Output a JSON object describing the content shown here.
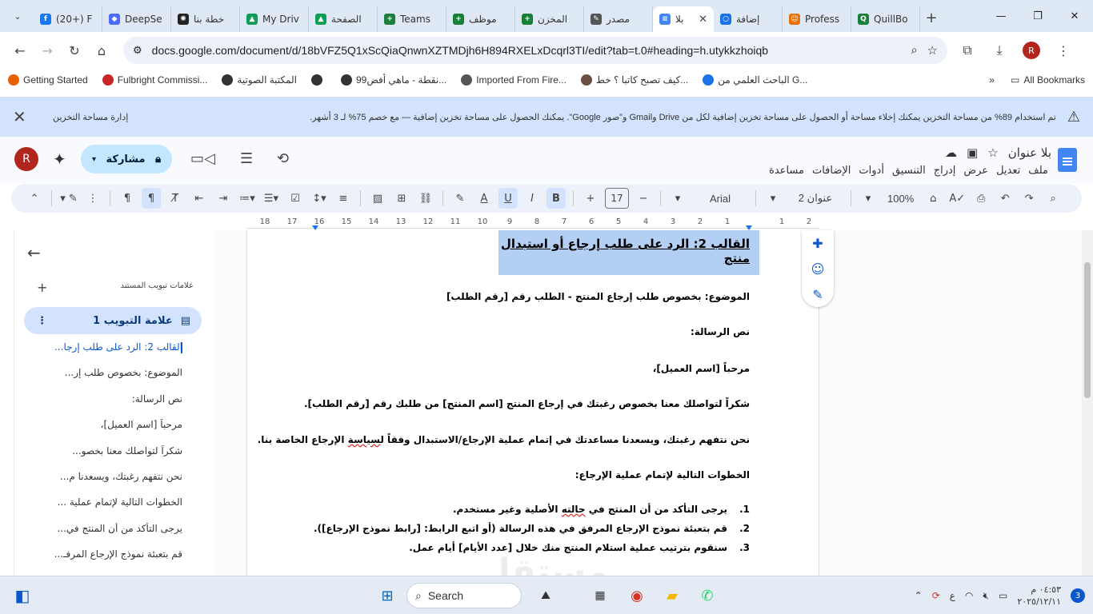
{
  "browser": {
    "tabs": [
      {
        "label": "(20+) F",
        "color": "#1877f2",
        "glyph": "f"
      },
      {
        "label": "DeepSe",
        "color": "#4d6bfe",
        "glyph": "◆"
      },
      {
        "label": "خطة بنا",
        "color": "#222222",
        "glyph": "✺"
      },
      {
        "label": "My Driv",
        "color": "#0f9d58",
        "glyph": "▲"
      },
      {
        "label": "الصفحة",
        "color": "#0f9d58",
        "glyph": "▲"
      },
      {
        "label": "Teams",
        "color": "#188038",
        "glyph": "+"
      },
      {
        "label": "موظف",
        "color": "#188038",
        "glyph": "+"
      },
      {
        "label": "المخزن",
        "color": "#188038",
        "glyph": "+"
      },
      {
        "label": "مصدر",
        "color": "#555555",
        "glyph": "✎"
      },
      {
        "label": "بلا",
        "color": "#4285f4",
        "glyph": "≡",
        "active": true
      },
      {
        "label": "إضافة",
        "color": "#1a73e8",
        "glyph": "○"
      },
      {
        "label": "Profess",
        "color": "#e8710a",
        "glyph": "☺"
      },
      {
        "label": "QuillBo",
        "color": "#188038",
        "glyph": "Q"
      }
    ],
    "url": "docs.google.com/document/d/18bVFZ5Q1xScQiaQnwnXZTMDjh6H894RXELxDcqrl3TI/edit?tab=t.0#heading=h.utykkzhoiqb",
    "profile_initial": "R"
  },
  "bookmarks": {
    "items": [
      {
        "label": "Getting Started",
        "color": "#e66000"
      },
      {
        "label": "Fulbright Commissi...",
        "color": "#c62828"
      },
      {
        "label": "المكتبة الصوتية",
        "color": "#333333"
      },
      {
        "label": "",
        "color": "#333333"
      },
      {
        "label": "99نقطة - ماهي أفض...",
        "color": "#333333"
      },
      {
        "label": "Imported From Fire...",
        "color": "#555555"
      },
      {
        "label": "كيف تصبح كاتبا ؟ خط...",
        "color": "#6d4c41"
      },
      {
        "label": "الباحث العلمي من G...",
        "color": "#1a73e8"
      }
    ],
    "more": "»",
    "all": "All Bookmarks"
  },
  "banner": {
    "manage": "إدارة مساحة التخزين",
    "message": "تم استخدام 89% من مساحة التخزين   يمكنك إخلاء مساحة أو الحصول على مساحة تخزين إضافية لكل من Drive وGmail و\"صور Google\". يمكنك الحصول على مساحة تخزين إضافية — مع خصم 75% لـ 3 أشهر."
  },
  "docs": {
    "user_initial": "R",
    "share_label": "مشاركة",
    "title": "بلا عنوان",
    "menus": [
      "ملف",
      "تعديل",
      "عرض",
      "إدراج",
      "التنسيق",
      "أدوات",
      "الإضافات",
      "مساعدة"
    ],
    "toolbar": {
      "zoom": "100%",
      "style": "عنوان 2",
      "font": "Arial",
      "size": "17"
    }
  },
  "ruler": {
    "numbers": [
      "2",
      "1",
      "",
      "1",
      "2",
      "3",
      "4",
      "5",
      "6",
      "7",
      "8",
      "9",
      "10",
      "11",
      "12",
      "13",
      "14",
      "15",
      "16",
      "17",
      "18"
    ]
  },
  "outline": {
    "tabs_title": "علامات تبويب المستند",
    "tab_label": "علامة التبويب 1",
    "items": [
      "القالب 2: الرد على طلب إرجا...",
      "الموضوع: بخصوص طلب إر...",
      "نص الرسالة:",
      "مرحباً [اسم العميل]،",
      "شكراً لتواصلك معنا بخصو...",
      "نحن نتفهم رغبتك، ويسعدنا م...",
      "الخطوات التالية لإتمام عملية ...",
      "يرجى التأكد من أن المنتج في...",
      "قم بتعبئة نموذج الإرجاع المرفـ..."
    ]
  },
  "document": {
    "heading": "القالب 2: الرد على طلب إرجاع أو استبدال منتج",
    "subject": "الموضوع: بخصوص طلب إرجاع المنتج - الطلب رقم [رقم الطلب]",
    "body_label": "نص الرسالة:",
    "greeting": "مرحباً [اسم العميل]،",
    "thanks": "شكراً لتواصلك معنا بخصوص رغبتك في إرجاع المنتج [اسم المنتج] من طلبك رقم [رقم الطلب].",
    "understand_pre": "نحن نتفهم رغبتك، ويسعدنا مساعدتك في إتمام عملية الإرجاع/الاستبدال وفقاً ل",
    "understand_squig": "سياسة",
    "understand_post": " الإرجاع الخاصة بنا.",
    "next_steps": "الخطوات التالية لإتمام عملية الإرجاع:",
    "steps": [
      {
        "n": "1.",
        "pre": "يرجى التأكد من أن المنتج في ",
        "sq": "حالته",
        "post": " الأصلية وغير مستخدم."
      },
      {
        "n": "2.",
        "pre": "قم بتعبئة نموذج الإرجاع المرفق في هذه الرسالة (أو اتبع الرابط: [رابط نموذج الإرجاع]).",
        "sq": "",
        "post": ""
      },
      {
        "n": "3.",
        "pre": "سنقوم بترتيب عملية استلام المنتج منك خلال [عدد الأيام] أيام عمل.",
        "sq": "",
        "post": ""
      }
    ]
  },
  "watermark": "مستقل",
  "taskbar": {
    "search": "Search",
    "time": "٠٤:٥٣ م",
    "date": "٢٠٢٥/١٢/١١",
    "lang": "ع",
    "badge": "3"
  }
}
